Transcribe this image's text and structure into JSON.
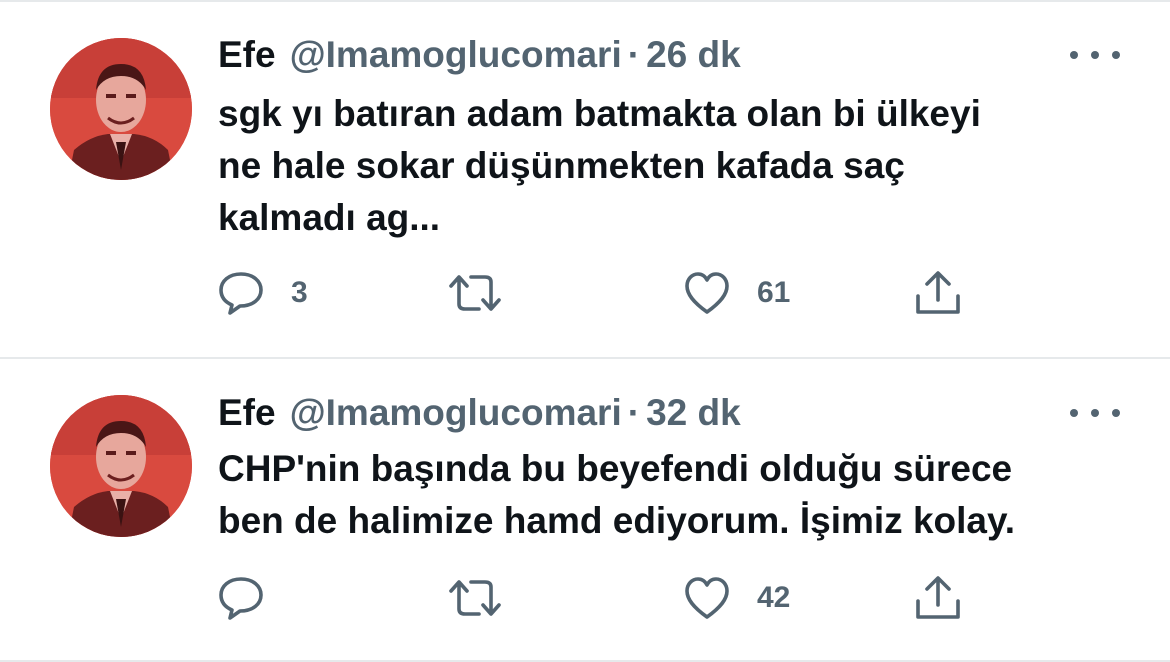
{
  "tweets": [
    {
      "author_name": "Efe",
      "handle": "@Imamoglucomari",
      "separator": "·",
      "time": "26 dk",
      "text_lines": [
        "sgk yı batıran adam batmakta olan bi ülkeyi",
        "ne hale sokar düşünmekten kafada saç",
        "kalmadı ag..."
      ],
      "reply_count": "3",
      "retweet_count": "",
      "like_count": "61"
    },
    {
      "author_name": "Efe",
      "handle": "@Imamoglucomari",
      "separator": "·",
      "time": "32 dk",
      "text_lines": [
        "CHP'nin başında bu beyefendi olduğu sürece",
        "ben de halimize hamd ediyorum. İşimiz kolay."
      ],
      "reply_count": "",
      "retweet_count": "",
      "like_count": "42"
    }
  ],
  "icons": {
    "reply": "reply-icon",
    "retweet": "retweet-icon",
    "like": "heart-icon",
    "share": "share-icon",
    "more": "more-icon"
  },
  "colors": {
    "text_primary": "#0f1419",
    "text_secondary": "#536471",
    "divider": "#e6e9eb",
    "avatar_tint": "#d94a3f"
  }
}
